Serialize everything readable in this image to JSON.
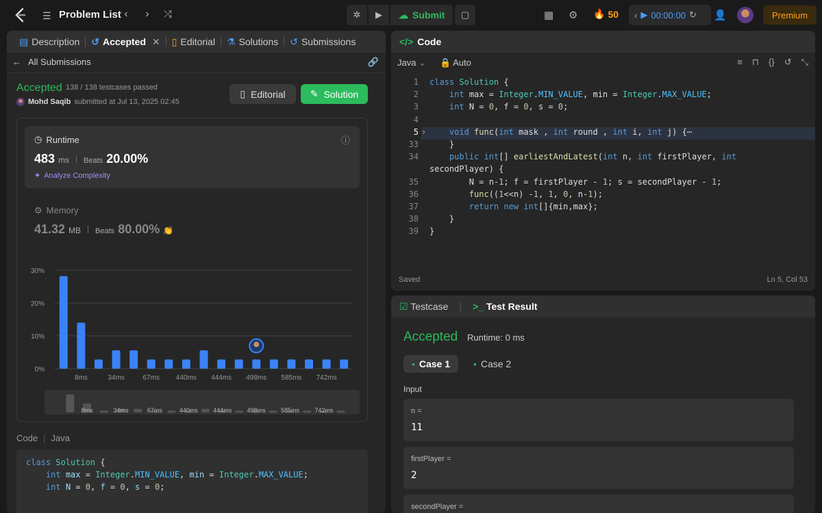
{
  "topbar": {
    "title": "Problem List",
    "submit_label": "Submit",
    "streak": "50",
    "timer": "00:00:00",
    "premium": "Premium"
  },
  "left_tabs": [
    {
      "label": "Description"
    },
    {
      "label": "Accepted"
    },
    {
      "label": "Editorial"
    },
    {
      "label": "Solutions"
    },
    {
      "label": "Submissions"
    }
  ],
  "submission": {
    "back_label": "All Submissions",
    "status": "Accepted",
    "passed": "138 / 138 testcases passed",
    "user": "Mohd Saqib",
    "submitted": "submitted at Jul 13, 2025 02:45",
    "editorial_btn": "Editorial",
    "solution_btn": "Solution"
  },
  "runtime": {
    "title": "Runtime",
    "value": "483",
    "unit": "ms",
    "beats_label": "Beats",
    "beats": "20.00%",
    "analyze": "Analyze Complexity"
  },
  "memory": {
    "title": "Memory",
    "value": "41.32",
    "unit": "MB",
    "beats_label": "Beats",
    "beats": "80.00%"
  },
  "chart_data": {
    "type": "bar",
    "title": "",
    "xlabel": "",
    "ylabel": "",
    "ylim": [
      0,
      30
    ],
    "yticks": [
      "30%",
      "20%",
      "10%",
      "0%"
    ],
    "xticks": [
      "8ms",
      "34ms",
      "67ms",
      "440ms",
      "444ms",
      "498ms",
      "585ms",
      "742ms"
    ],
    "values": [
      28.2,
      14,
      2.8,
      5.6,
      5.6,
      2.8,
      2.8,
      2.8,
      5.6,
      2.8,
      2.8,
      2.8,
      2.8,
      2.8,
      2.8,
      2.8,
      2.8
    ],
    "highlight_index": 11,
    "bar_color": "#3b82f6"
  },
  "code_preview": {
    "head_code": "Code",
    "head_lang": "Java",
    "lines": [
      "class Solution {",
      "    int max = Integer.MIN_VALUE, min = Integer.MAX_VALUE;",
      "    int N = 0, f = 0, s = 0;"
    ]
  },
  "editor": {
    "tab_label": "Code",
    "language": "Java",
    "mode": "Auto",
    "saved": "Saved",
    "cursor": "Ln 5, Col 53",
    "line_numbers": [
      "1",
      "2",
      "3",
      "4",
      "5",
      "33",
      "34",
      "",
      "35",
      "36",
      "37",
      "38",
      "39"
    ],
    "lines": [
      "class Solution {",
      "    int max = Integer.MIN_VALUE, min = Integer.MAX_VALUE;",
      "    int N = 0, f = 0, s = 0;",
      "",
      "    void func(int mask , int round , int i, int j) {⋯",
      "    }",
      "    public int[] earliestAndLatest(int n, int firstPlayer, int",
      "secondPlayer) {",
      "        N = n-1; f = firstPlayer - 1; s = secondPlayer - 1;",
      "        func((1<<n) -1, 1, 0, n-1);",
      "        return new int[]{min,max};",
      "    }",
      "}"
    ]
  },
  "result": {
    "testcase_tab": "Testcase",
    "result_tab": "Test Result",
    "status": "Accepted",
    "runtime": "Runtime: 0 ms",
    "case1": "Case 1",
    "case2": "Case 2",
    "input_label": "Input",
    "inputs": [
      {
        "key": "n =",
        "value": "11"
      },
      {
        "key": "firstPlayer =",
        "value": "2"
      },
      {
        "key": "secondPlayer =",
        "value": ""
      }
    ]
  }
}
